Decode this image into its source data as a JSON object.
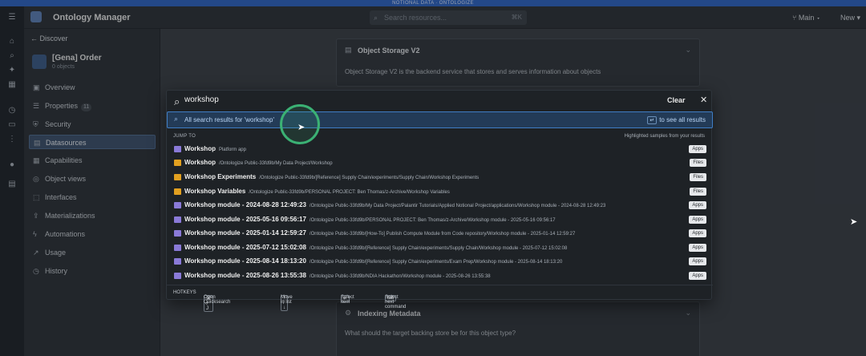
{
  "banner": "NOTIONAL DATA · ONTOLOGIZE",
  "app": {
    "title": "Ontology Manager"
  },
  "search": {
    "placeholder": "Search resources...",
    "shortcut": "⌘K"
  },
  "header": {
    "branch": "Main",
    "new_label": "New"
  },
  "sidebar": {
    "back_label": "Discover",
    "object_name": "[Gena] Order",
    "object_count": "0 objects",
    "items": [
      {
        "label": "Overview",
        "icon": "overview-icon"
      },
      {
        "label": "Properties",
        "badge": "11",
        "icon": "properties-icon"
      },
      {
        "label": "Security",
        "icon": "shield-icon"
      },
      {
        "label": "Datasources",
        "icon": "database-icon",
        "active": true
      },
      {
        "label": "Capabilities",
        "icon": "capabilities-icon"
      },
      {
        "label": "Object views",
        "icon": "object-views-icon"
      },
      {
        "label": "Interfaces",
        "icon": "interfaces-icon"
      },
      {
        "label": "Materializations",
        "icon": "materializations-icon"
      },
      {
        "label": "Automations",
        "icon": "automations-icon"
      },
      {
        "label": "Usage",
        "icon": "usage-icon"
      },
      {
        "label": "History",
        "icon": "history-icon"
      }
    ]
  },
  "content": {
    "storage_title": "Object Storage V2",
    "storage_desc": "Object Storage V2 is the backend service that stores and serves information about objects",
    "indexing_title": "Indexing Metadata",
    "indexing_desc": "What should the target backing store be for this object type?"
  },
  "quicksearch": {
    "query": "workshop",
    "clear_label": "Clear",
    "all_results": "All search results for 'workshop'",
    "see_all": "to see all results",
    "jump_to": "JUMP TO",
    "highlighted": "Highlighted samples from your results",
    "results": [
      {
        "name": "Workshop",
        "path": "Platform app",
        "tag": "Apps",
        "kind": "app"
      },
      {
        "name": "Workshop",
        "path": "/Ontologize Public-33fd9b/My Data Project/Workshop",
        "tag": "Files",
        "kind": "folder"
      },
      {
        "name": "Workshop Experiments",
        "path": "/Ontologize Public-33fd9b/[Reference] Supply Chain/experiments/Supply Chain/Workshop Experiments",
        "tag": "Files",
        "kind": "folder"
      },
      {
        "name": "Workshop Variables",
        "path": "/Ontologize Public-33fd9b/PERSONAL PROJECT: Ben Thomas/z-Archive/Workshop Variables",
        "tag": "Files",
        "kind": "folder"
      },
      {
        "name": "Workshop module - 2024-08-28 12:49:23",
        "path": "/Ontologize Public-33fd9b/My Data Project/Palantir Tutorials/Applied Notional Project/applications/Workshop module - 2024-08-28 12:49:23",
        "tag": "Apps",
        "kind": "app"
      },
      {
        "name": "Workshop module - 2025-05-16 09:56:17",
        "path": "/Ontologize Public-33fd9b/PERSONAL PROJECT: Ben Thomas/z-Archive/Workshop module - 2025-05-16 09:56:17",
        "tag": "Apps",
        "kind": "app"
      },
      {
        "name": "Workshop module - 2025-01-14 12:59:27",
        "path": "/Ontologize Public-33fd9b/[How-To] Publish Compute Module from Code repository/Workshop module - 2025-01-14 12:59:27",
        "tag": "Apps",
        "kind": "app"
      },
      {
        "name": "Workshop module - 2025-07-12 15:02:08",
        "path": "/Ontologize Public-33fd9b/[Reference] Supply Chain/experiments/Supply Chain/Workshop module - 2025-07-12 15:02:08",
        "tag": "Apps",
        "kind": "app"
      },
      {
        "name": "Workshop module - 2025-08-14 18:13:20",
        "path": "/Ontologize Public-33fd9b/[Reference] Supply Chain/experiments/Exam Prep/Workshop module - 2025-08-14 18:13:20",
        "tag": "Apps",
        "kind": "app"
      },
      {
        "name": "Workshop module - 2025-08-26 13:55:38",
        "path": "/Ontologize Public-33fd9b/NDIA Hackathon/Workshop module - 2025-08-26 13:55:38",
        "tag": "Apps",
        "kind": "app"
      }
    ],
    "footer": {
      "hotkeys": "HOTKEYS",
      "open_keys": "⌘ + J",
      "open_label": "Open Quicksearch",
      "move_keys": "↑ / ↓",
      "move_label": "Move in list",
      "select_key": "↵",
      "select_label": "Select item",
      "tab_key": "tab",
      "tab_label": "Select next command"
    }
  }
}
